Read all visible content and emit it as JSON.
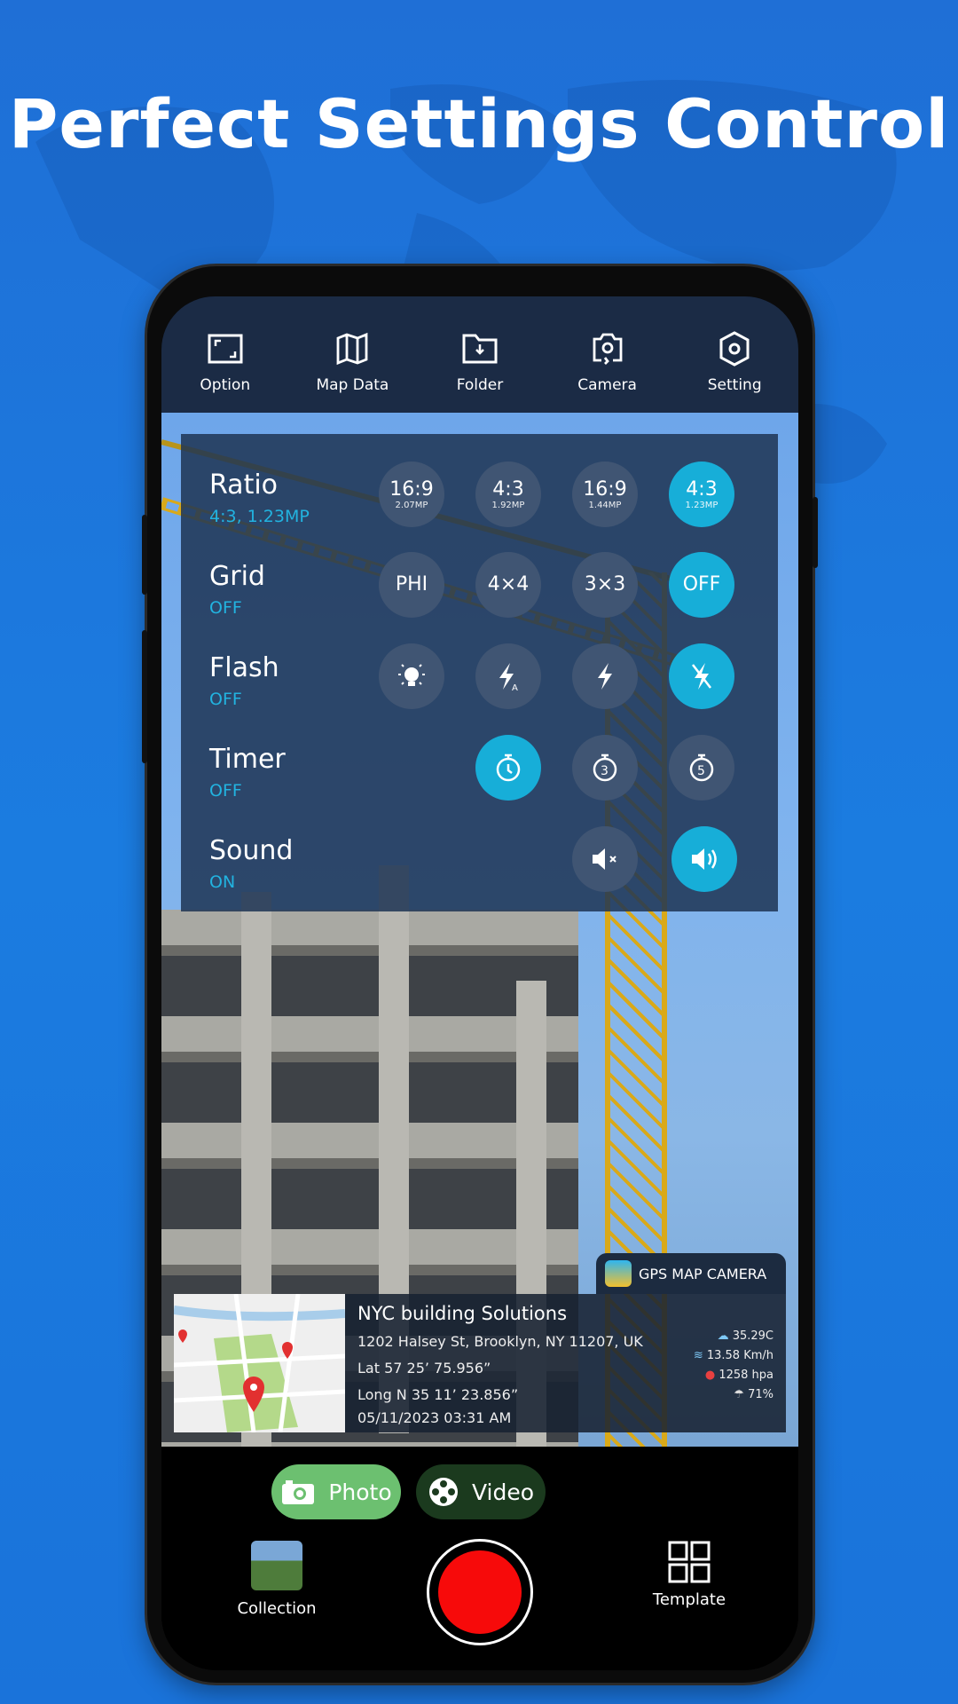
{
  "headline": "Perfect Settings Control",
  "topbar": {
    "items": [
      {
        "label": "Option",
        "icon": "option-frame-icon"
      },
      {
        "label": "Map Data",
        "icon": "map-icon"
      },
      {
        "label": "Folder",
        "icon": "folder-download-icon"
      },
      {
        "label": "Camera",
        "icon": "camera-switch-icon"
      },
      {
        "label": "Setting",
        "icon": "hexagon-gear-icon"
      }
    ]
  },
  "settings": {
    "ratio": {
      "label": "Ratio",
      "value": "4:3, 1.23MP",
      "options": [
        {
          "ratio": "16:9",
          "mp": "2.07MP"
        },
        {
          "ratio": "4:3",
          "mp": "1.92MP"
        },
        {
          "ratio": "16:9",
          "mp": "1.44MP"
        },
        {
          "ratio": "4:3",
          "mp": "1.23MP",
          "selected": true
        }
      ]
    },
    "grid": {
      "label": "Grid",
      "value": "OFF",
      "options": [
        "PHI",
        "4×4",
        "3×3",
        "OFF"
      ],
      "selected": "OFF"
    },
    "flash": {
      "label": "Flash",
      "value": "OFF",
      "options": [
        "torch",
        "auto",
        "on",
        "off"
      ],
      "selected": "off"
    },
    "timer": {
      "label": "Timer",
      "value": "OFF",
      "options": [
        "off",
        "3",
        "5"
      ],
      "selected": "off"
    },
    "sound": {
      "label": "Sound",
      "value": "ON",
      "options": [
        "mute",
        "on"
      ],
      "selected": "on"
    }
  },
  "stamp": {
    "brand": "GPS MAP CAMERA",
    "name": "NYC building Solutions",
    "address": "1202 Halsey St, Brooklyn, NY 11207, UK",
    "lat": "Lat 57 25’ 75.956”",
    "long": "Long N 35 11’ 23.856”",
    "datetime": "05/11/2023  03:31 AM",
    "weather": {
      "temp": "35.29C",
      "wind": "13.58 Km/h",
      "pressure": "1258 hpa",
      "humidity": "71%"
    }
  },
  "modes": {
    "photo": "Photo",
    "video": "Video",
    "selected": "Photo"
  },
  "bottom": {
    "collection": "Collection",
    "template": "Template"
  },
  "colors": {
    "accent": "#17aed8",
    "topbar": "#1b2b45",
    "photo": "#6cc070",
    "video": "#1b3a1e",
    "shutter": "#f70a0a"
  }
}
